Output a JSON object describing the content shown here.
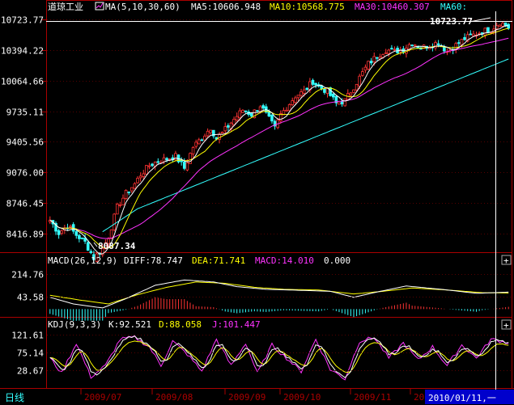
{
  "colors": {
    "bg": "#000000",
    "border": "#aa0000",
    "up": "#ff3333",
    "down": "#33ffff",
    "ma5": "#ffffff",
    "ma10": "#ffff00",
    "ma30": "#ff33ff",
    "ma60": "#33ffff",
    "axisText": "#ffffff",
    "kdjK": "#ffffff",
    "kdjD": "#ffff00",
    "kdjJ": "#ff33ff",
    "dateBox": "#0000cc"
  },
  "header": {
    "title": "道琼工业",
    "ma_label": "MA(5,10,30,60)",
    "ma5": "MA5:10606.948",
    "ma10": "MA10:10568.775",
    "ma30": "MA30:10460.307",
    "ma60": "MA60:"
  },
  "macd_header": {
    "label": "MACD(26,12,9)",
    "diff": "DIFF:78.747",
    "dea": "DEA:71.741",
    "macd": "MACD:14.010",
    "extra": "0.000"
  },
  "kdj_header": {
    "label": "KDJ(9,3,3)",
    "k": "K:92.521",
    "d": "D:88.058",
    "j": "J:101.447"
  },
  "footer": {
    "tab": "日线",
    "dates": [
      "2009/07",
      "2009/08",
      "2009/09",
      "2009/10",
      "2009/11",
      "20"
    ],
    "cursor_date": "2010/01/11,一"
  },
  "chart_data": [
    {
      "type": "candlestick",
      "pane": "price",
      "yticks": [
        "10723.77",
        "10394.22",
        "10064.66",
        "9735.11",
        "9405.56",
        "9076.00",
        "8746.45",
        "8416.89"
      ],
      "ytick_values": [
        10723.77,
        10394.22,
        10064.66,
        9735.11,
        9405.56,
        9076.0,
        8746.45,
        8416.89
      ],
      "ylim": [
        8230,
        10780
      ],
      "annotations": {
        "high": "10723.77",
        "low": "8087.34"
      },
      "close_anchors": [
        [
          0,
          8560
        ],
        [
          3,
          8420
        ],
        [
          6,
          8500
        ],
        [
          9,
          8400
        ],
        [
          12,
          8320
        ],
        [
          15,
          8150
        ],
        [
          18,
          8250
        ],
        [
          20,
          8380
        ],
        [
          23,
          8700
        ],
        [
          26,
          8850
        ],
        [
          29,
          8950
        ],
        [
          31,
          9050
        ],
        [
          34,
          9150
        ],
        [
          37,
          9200
        ],
        [
          40,
          9220
        ],
        [
          43,
          9250
        ],
        [
          46,
          9120
        ],
        [
          49,
          9350
        ],
        [
          52,
          9450
        ],
        [
          55,
          9560
        ],
        [
          57,
          9440
        ],
        [
          59,
          9500
        ],
        [
          63,
          9650
        ],
        [
          66,
          9750
        ],
        [
          69,
          9700
        ],
        [
          72,
          9800
        ],
        [
          75,
          9650
        ],
        [
          77,
          9550
        ],
        [
          79,
          9700
        ],
        [
          82,
          9820
        ],
        [
          84,
          9900
        ],
        [
          87,
          9950
        ],
        [
          90,
          10060
        ],
        [
          92,
          10000
        ],
        [
          95,
          9950
        ],
        [
          98,
          9820
        ],
        [
          101,
          9850
        ],
        [
          103,
          9950
        ],
        [
          106,
          10100
        ],
        [
          109,
          10250
        ],
        [
          112,
          10330
        ],
        [
          115,
          10400
        ],
        [
          118,
          10380
        ],
        [
          121,
          10410
        ],
        [
          124,
          10480
        ],
        [
          127,
          10420
        ],
        [
          130,
          10450
        ],
        [
          133,
          10480
        ],
        [
          136,
          10380
        ],
        [
          139,
          10450
        ],
        [
          142,
          10520
        ],
        [
          145,
          10560
        ],
        [
          148,
          10600
        ],
        [
          151,
          10620
        ],
        [
          154,
          10700
        ],
        [
          157,
          10640
        ]
      ],
      "candle_count": 158
    },
    {
      "type": "bar+line",
      "pane": "macd",
      "yticks": [
        "214.76",
        "43.58"
      ],
      "ytick_values": [
        214.76,
        43.58
      ],
      "ylim": [
        -95,
        245
      ],
      "diff_anchors": [
        [
          0,
          40
        ],
        [
          8,
          -10
        ],
        [
          18,
          -40
        ],
        [
          26,
          30
        ],
        [
          36,
          130
        ],
        [
          46,
          170
        ],
        [
          56,
          155
        ],
        [
          64,
          120
        ],
        [
          74,
          100
        ],
        [
          82,
          95
        ],
        [
          96,
          85
        ],
        [
          104,
          40
        ],
        [
          112,
          80
        ],
        [
          122,
          125
        ],
        [
          134,
          100
        ],
        [
          146,
          70
        ],
        [
          157,
          79
        ]
      ],
      "dea_anchors": [
        [
          0,
          55
        ],
        [
          10,
          20
        ],
        [
          20,
          -10
        ],
        [
          30,
          60
        ],
        [
          40,
          115
        ],
        [
          50,
          155
        ],
        [
          60,
          145
        ],
        [
          70,
          115
        ],
        [
          80,
          100
        ],
        [
          92,
          95
        ],
        [
          104,
          65
        ],
        [
          114,
          85
        ],
        [
          124,
          110
        ],
        [
          136,
          95
        ],
        [
          148,
          75
        ],
        [
          157,
          72
        ]
      ]
    },
    {
      "type": "line",
      "pane": "kdj",
      "yticks": [
        "121.61",
        "75.14",
        "28.67"
      ],
      "ytick_values": [
        121.61,
        75.14,
        28.67
      ],
      "ylim": [
        -15,
        135
      ],
      "j_anchors": [
        [
          0,
          60
        ],
        [
          4,
          20
        ],
        [
          9,
          100
        ],
        [
          14,
          10
        ],
        [
          19,
          40
        ],
        [
          24,
          110
        ],
        [
          29,
          115
        ],
        [
          34,
          90
        ],
        [
          38,
          40
        ],
        [
          42,
          105
        ],
        [
          47,
          70
        ],
        [
          52,
          25
        ],
        [
          57,
          110
        ],
        [
          62,
          40
        ],
        [
          67,
          100
        ],
        [
          71,
          20
        ],
        [
          76,
          95
        ],
        [
          81,
          60
        ],
        [
          86,
          25
        ],
        [
          91,
          110
        ],
        [
          96,
          30
        ],
        [
          101,
          5
        ],
        [
          106,
          105
        ],
        [
          111,
          115
        ],
        [
          116,
          60
        ],
        [
          121,
          100
        ],
        [
          126,
          55
        ],
        [
          131,
          90
        ],
        [
          136,
          40
        ],
        [
          141,
          95
        ],
        [
          146,
          60
        ],
        [
          151,
          110
        ],
        [
          157,
          101
        ]
      ]
    }
  ]
}
